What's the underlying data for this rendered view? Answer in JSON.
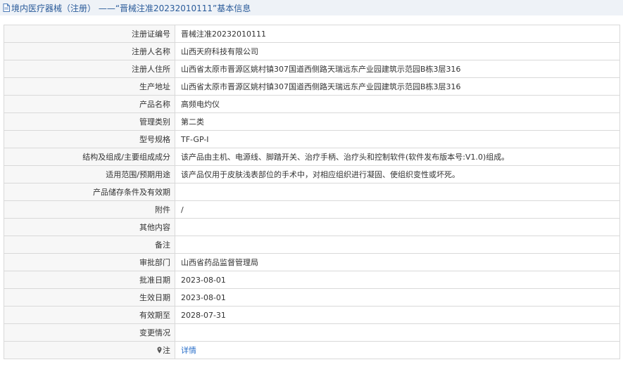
{
  "header": {
    "title": "境内医疗器械（注册） ——“晋械注准20232010111”基本信息"
  },
  "rows": [
    {
      "label": "注册证编号",
      "value": "晋械注准20232010111"
    },
    {
      "label": "注册人名称",
      "value": "山西天府科技有限公司"
    },
    {
      "label": "注册人住所",
      "value": "山西省太原市晋源区姚村镇307国道西侧路天瑞远东产业园建筑示范园B栋3层316"
    },
    {
      "label": "生产地址",
      "value": "山西省太原市晋源区姚村镇307国道西侧路天瑞远东产业园建筑示范园B栋3层316"
    },
    {
      "label": "产品名称",
      "value": "高频电灼仪"
    },
    {
      "label": "管理类别",
      "value": "第二类"
    },
    {
      "label": "型号规格",
      "value": "TF-GP-I"
    },
    {
      "label": "结构及组成/主要组成成分",
      "value": "该产品由主机、电源线、脚踏开关、治疗手柄、治疗头和控制软件(软件发布版本号:V1.0)组成。"
    },
    {
      "label": "适用范围/预期用途",
      "value": "该产品仅用于皮肤浅表部位的手术中，对相应组织进行凝固、使组织变性或坏死。"
    },
    {
      "label": "产品储存条件及有效期",
      "value": ""
    },
    {
      "label": "附件",
      "value": "/"
    },
    {
      "label": "其他内容",
      "value": ""
    },
    {
      "label": "备注",
      "value": ""
    },
    {
      "label": "审批部门",
      "value": "山西省药品监督管理局"
    },
    {
      "label": "批准日期",
      "value": "2023-08-01"
    },
    {
      "label": "生效日期",
      "value": "2023-08-01"
    },
    {
      "label": "有效期至",
      "value": "2028-07-31"
    },
    {
      "label": "变更情况",
      "value": ""
    }
  ],
  "note": {
    "label": "注",
    "link_text": "详情",
    "icon": "map-pin-icon"
  },
  "colors": {
    "header_bg": "#eef2f7",
    "header_text": "#2a5b9a",
    "label_bg": "#f7f7f7",
    "border": "#d9d9d9",
    "link": "#2a6fc9"
  }
}
